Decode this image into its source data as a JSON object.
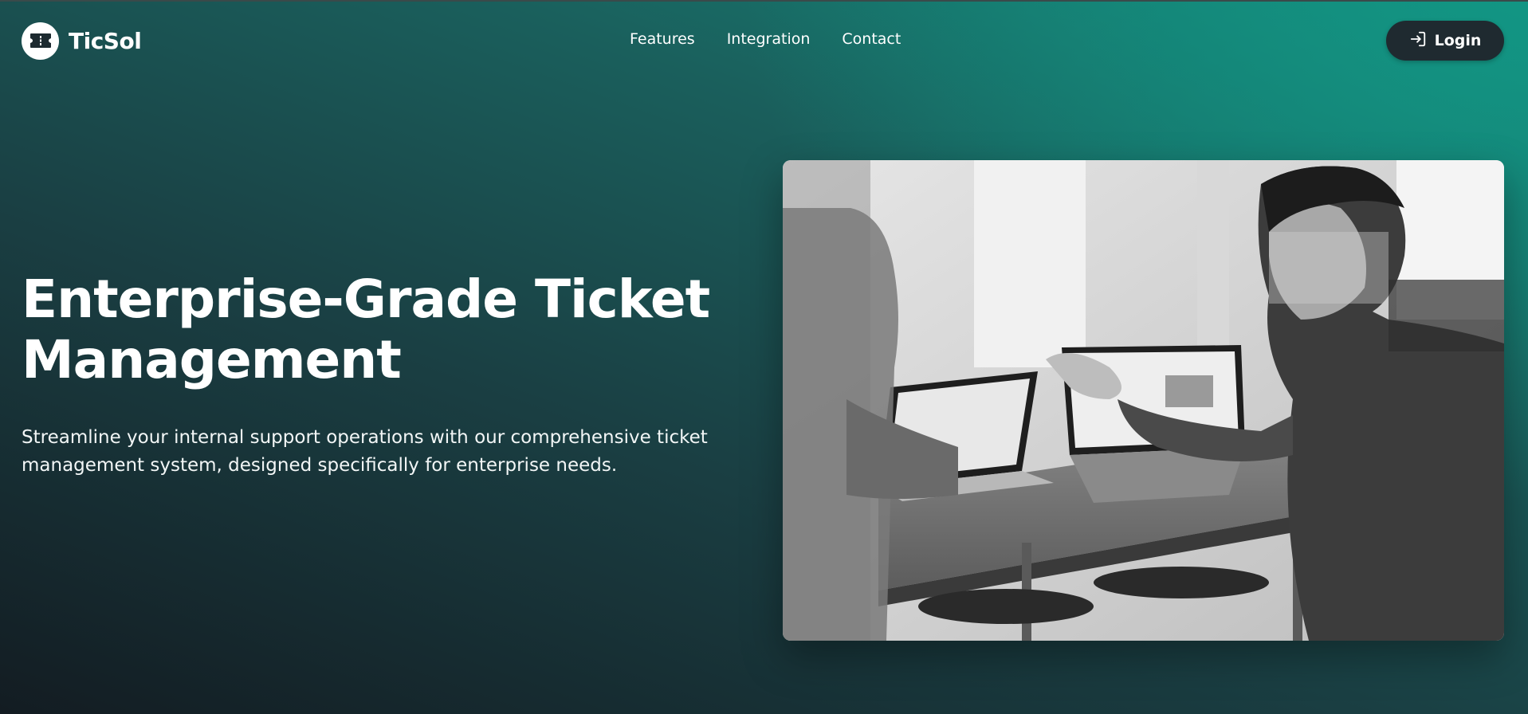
{
  "brand": {
    "name": "TicSol",
    "logo_icon": "ticket-icon"
  },
  "nav": {
    "links": [
      {
        "label": "Features"
      },
      {
        "label": "Integration"
      },
      {
        "label": "Contact"
      }
    ]
  },
  "login": {
    "label": "Login",
    "icon": "sign-in-icon"
  },
  "hero": {
    "title": "Enterprise-Grade Ticket Management",
    "subtitle": "Streamline your internal support operations with our comprehensive ticket management system, designed specifically for enterprise needs.",
    "image_icon": "team-working-photo"
  },
  "colors": {
    "accent": "#129684",
    "button_bg": "#1f2a30",
    "text": "#ffffff"
  }
}
